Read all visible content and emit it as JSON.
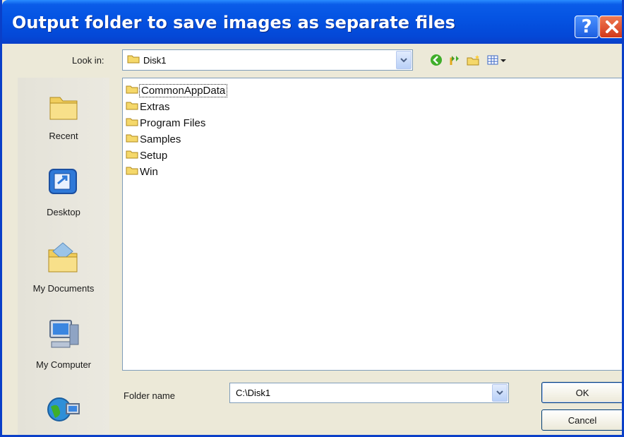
{
  "window": {
    "title": "Output folder to save images as separate files",
    "help_glyph": "?",
    "close_glyph": "✕"
  },
  "toolbar": {
    "lookin_label": "Look in:",
    "lookin_value": "Disk1",
    "nav_icons": [
      "back-icon",
      "up-folder-icon",
      "new-folder-icon",
      "views-menu-icon"
    ]
  },
  "places": [
    {
      "label": "Recent",
      "icon": "recent-folder-icon"
    },
    {
      "label": "Desktop",
      "icon": "desktop-icon"
    },
    {
      "label": "My Documents",
      "icon": "my-documents-icon"
    },
    {
      "label": "My Computer",
      "icon": "my-computer-icon"
    },
    {
      "label": "",
      "icon": "network-places-icon"
    }
  ],
  "files": [
    {
      "name": "CommonAppData",
      "selected": true
    },
    {
      "name": "Extras"
    },
    {
      "name": "Program Files"
    },
    {
      "name": "Samples"
    },
    {
      "name": "Setup"
    },
    {
      "name": "Win"
    }
  ],
  "footer": {
    "folder_name_label": "Folder name",
    "folder_name_value": "C:\\Disk1",
    "ok_label": "OK",
    "cancel_label": "Cancel"
  },
  "colors": {
    "titlebar": "#0554e3",
    "folder": "#f5d86a",
    "dialog_bg": "#ece9d8"
  }
}
